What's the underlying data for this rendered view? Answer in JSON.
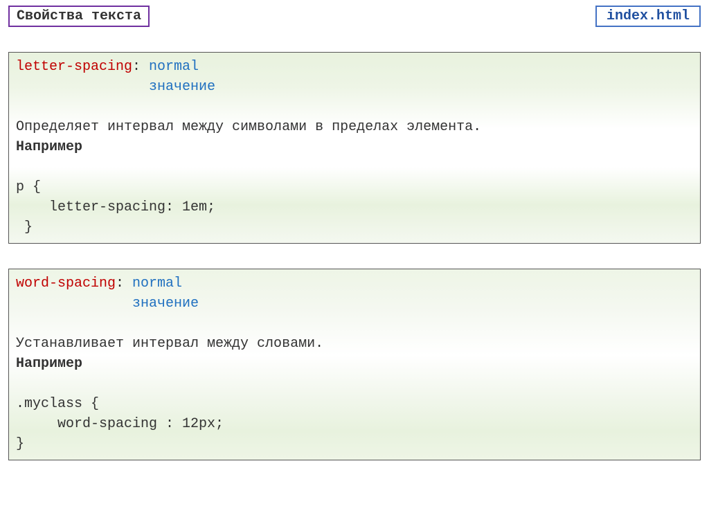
{
  "header": {
    "title": "Свойства текста",
    "filename": "index.html"
  },
  "blocks": [
    {
      "property": "letter-spacing",
      "colon": ": ",
      "value1": "normal",
      "value2_indent": "                ",
      "value2": "значение",
      "description": "Определяет интервал между символами в пределах элемента.",
      "example_label": "Например",
      "code_line1": "p {",
      "code_line2": "    letter-spacing: 1em;",
      "code_line3": " }"
    },
    {
      "property": "word-spacing",
      "colon": ": ",
      "value1": "normal",
      "value2_indent": "              ",
      "value2": "значение",
      "description": "Устанавливает интервал между словами.",
      "example_label": "Например",
      "code_line1": ".myclass {",
      "code_line2": "     word-spacing : 12px;",
      "code_line3": "}"
    }
  ]
}
